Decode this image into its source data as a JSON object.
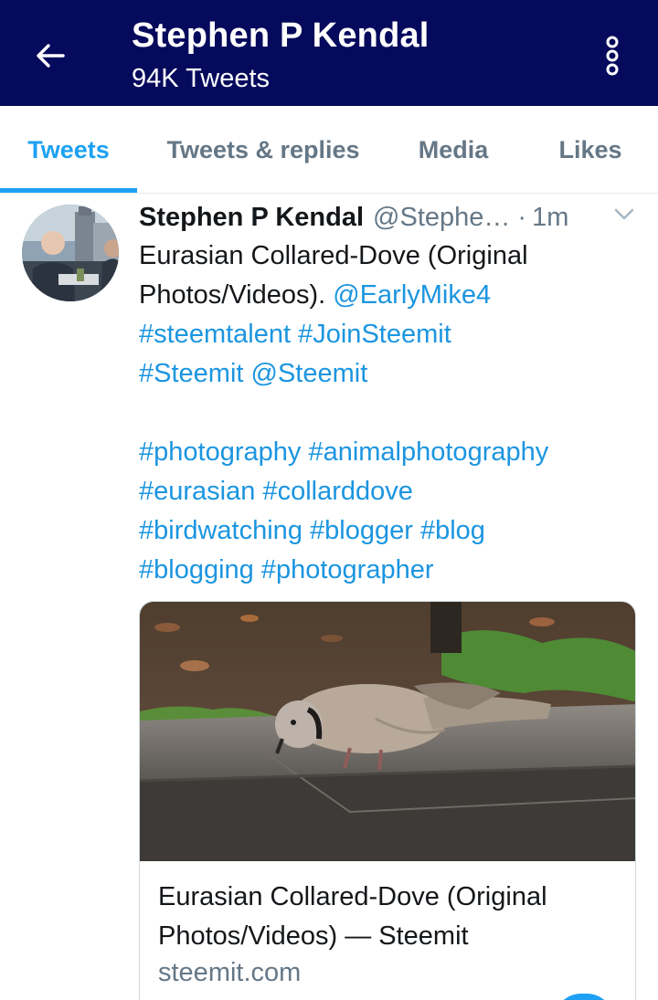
{
  "header": {
    "title": "Stephen P Kendal",
    "subtitle": "94K Tweets",
    "background": "#050a5c",
    "back_icon": "arrow-left-icon",
    "more_icon": "more-vertical-icon"
  },
  "tabs": [
    {
      "label": "Tweets",
      "active": true
    },
    {
      "label": "Tweets & replies",
      "active": false
    },
    {
      "label": "Media",
      "active": false
    },
    {
      "label": "Likes",
      "active": false
    }
  ],
  "accent_color": "#1da1f2",
  "tweet": {
    "name": "Stephen P Kendal",
    "handle": "@Stephe…",
    "separator": "·",
    "time": "1m",
    "menu_icon": "chevron-down-icon",
    "lines": [
      [
        {
          "text": "Eurasian Collared-Dove (Original",
          "link": false
        }
      ],
      [
        {
          "text": "Photos/Videos). ",
          "link": false
        },
        {
          "text": "@EarlyMike4",
          "link": true
        }
      ],
      [
        {
          "text": "#steemtalent",
          "link": true
        },
        {
          "text": " ",
          "link": false
        },
        {
          "text": "#JoinSteemit",
          "link": true
        }
      ],
      [
        {
          "text": "#Steemit",
          "link": true
        },
        {
          "text": " ",
          "link": false
        },
        {
          "text": "@Steemit",
          "link": true
        }
      ],
      [],
      [
        {
          "text": "#photography",
          "link": true
        },
        {
          "text": " ",
          "link": false
        },
        {
          "text": "#animalphotography",
          "link": true
        }
      ],
      [
        {
          "text": "#eurasian",
          "link": true
        },
        {
          "text": " ",
          "link": false
        },
        {
          "text": "#collarddove",
          "link": true
        }
      ],
      [
        {
          "text": "#birdwatching",
          "link": true
        },
        {
          "text": " ",
          "link": false
        },
        {
          "text": "#blogger",
          "link": true
        },
        {
          "text": " ",
          "link": false
        },
        {
          "text": "#blog",
          "link": true
        }
      ],
      [
        {
          "text": "#blogging",
          "link": true
        },
        {
          "text": " ",
          "link": false
        },
        {
          "text": "#photographer",
          "link": true
        }
      ]
    ],
    "card": {
      "title_line1": "Eurasian Collared-Dove (Original",
      "title_line2": "Photos/Videos) — Steemit",
      "domain": "steemit.com"
    }
  }
}
